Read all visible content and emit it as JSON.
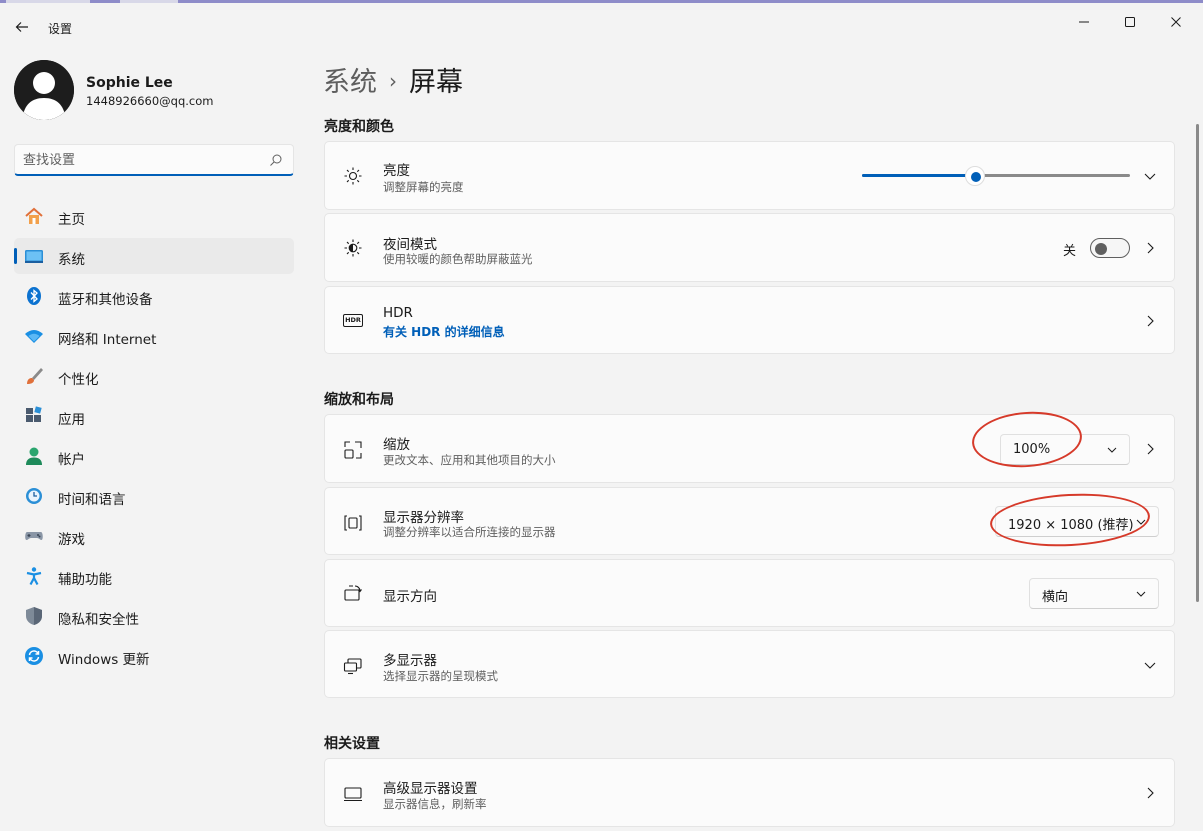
{
  "window": {
    "title": "设置",
    "controls": [
      "minimize-icon",
      "maximize-icon",
      "close-icon"
    ]
  },
  "user": {
    "name": "Sophie Lee",
    "email": "1448926660@qq.com"
  },
  "search": {
    "placeholder": "查找设置"
  },
  "sidebar": {
    "active_index": 1,
    "items": [
      {
        "label": "主页",
        "icon": "home-icon"
      },
      {
        "label": "系统",
        "icon": "system-icon"
      },
      {
        "label": "蓝牙和其他设备",
        "icon": "bluetooth-icon"
      },
      {
        "label": "网络和 Internet",
        "icon": "wifi-icon"
      },
      {
        "label": "个性化",
        "icon": "brush-icon"
      },
      {
        "label": "应用",
        "icon": "apps-icon"
      },
      {
        "label": "帐户",
        "icon": "account-icon"
      },
      {
        "label": "时间和语言",
        "icon": "clock-globe-icon"
      },
      {
        "label": "游戏",
        "icon": "gamepad-icon"
      },
      {
        "label": "辅助功能",
        "icon": "accessibility-icon"
      },
      {
        "label": "隐私和安全性",
        "icon": "shield-icon"
      },
      {
        "label": "Windows 更新",
        "icon": "update-icon"
      }
    ]
  },
  "breadcrumb": {
    "parent": "系统",
    "separator": "›",
    "current": "屏幕"
  },
  "sections": {
    "brightness_color": {
      "title": "亮度和颜色",
      "brightness": {
        "title": "亮度",
        "desc": "调整屏幕的亮度",
        "value_percent": 42
      },
      "night_light": {
        "title": "夜间模式",
        "desc": "使用较暖的颜色帮助屏蔽蓝光",
        "state_label": "关",
        "on": false
      },
      "hdr": {
        "title": "HDR",
        "link": "有关 HDR 的详细信息",
        "icon_text": "HDR"
      }
    },
    "scale_layout": {
      "title": "缩放和布局",
      "scale": {
        "title": "缩放",
        "desc": "更改文本、应用和其他项目的大小",
        "value": "100%"
      },
      "resolution": {
        "title": "显示器分辨率",
        "desc": "调整分辨率以适合所连接的显示器",
        "value": "1920 × 1080 (推荐)"
      },
      "orientation": {
        "title": "显示方向",
        "value": "横向"
      },
      "multi_display": {
        "title": "多显示器",
        "desc": "选择显示器的呈现模式"
      }
    },
    "related": {
      "title": "相关设置",
      "advanced_display": {
        "title": "高级显示器设置",
        "desc": "显示器信息，刷新率"
      }
    }
  },
  "colors": {
    "accent": "#005fb8",
    "annotation": "#d63a2a",
    "background": "#f3f3f3",
    "card": "#fbfbfb"
  }
}
